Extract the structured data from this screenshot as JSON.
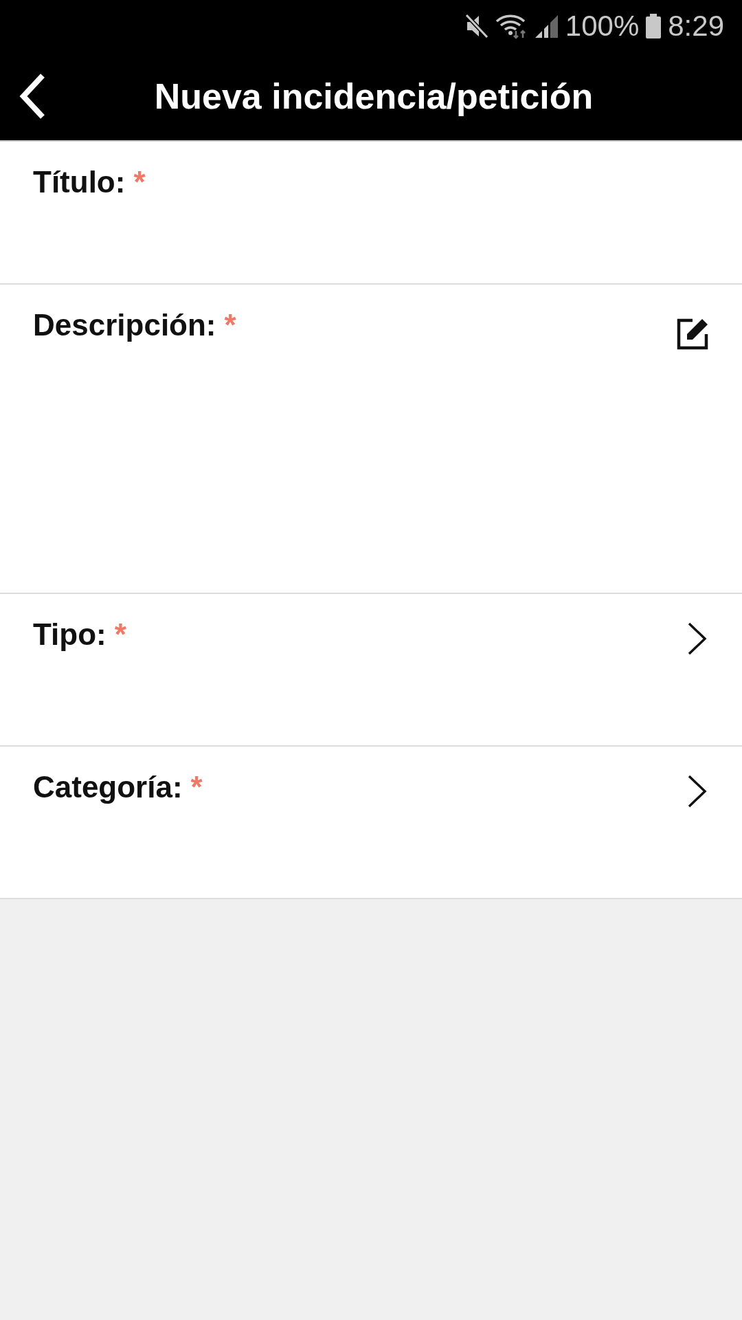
{
  "status_bar": {
    "battery": "100%",
    "time": "8:29"
  },
  "header": {
    "title": "Nueva incidencia/petición"
  },
  "fields": [
    {
      "label": "Título:",
      "required_mark": "*",
      "kind": "text"
    },
    {
      "label": "Descripción:",
      "required_mark": "*",
      "kind": "editor"
    },
    {
      "label": "Tipo:",
      "required_mark": "*",
      "kind": "picker"
    },
    {
      "label": "Categoría:",
      "required_mark": "*",
      "kind": "picker"
    }
  ]
}
